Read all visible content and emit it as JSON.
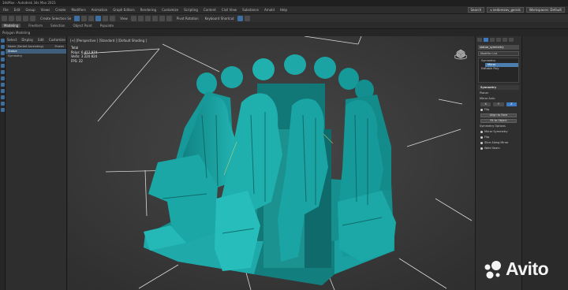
{
  "titlebar": {
    "text": "3dsMax - Autodesk 3ds Max 2023"
  },
  "menubar": {
    "items": [
      "File",
      "Edit",
      "Group",
      "Views",
      "Create",
      "Modifiers",
      "Animation",
      "Graph Editors",
      "Rendering",
      "Customize",
      "Scripting",
      "Content",
      "Civil View",
      "Substance",
      "Arnold",
      "Help"
    ],
    "user": "v.nedorezov_gerals",
    "workspace": "Workspaces: Default",
    "search_placeholder": "Search"
  },
  "toolbar": {
    "field": "Create Selection Se",
    "view": "View",
    "dropdown_a": "Pivot Rotation",
    "dropdown_b": "Keyboard Shortcut"
  },
  "ribbon": {
    "tabs": [
      "Modeling",
      "Freeform",
      "Selection",
      "Object Paint",
      "Populate"
    ],
    "active": "Modeling",
    "sub": "Polygon Modeling"
  },
  "scene": {
    "tabs": [
      "Select",
      "Display",
      "Edit",
      "Customize"
    ],
    "header": "Name (Sorted Ascending)",
    "header_right": "Frozen",
    "rows": [
      {
        "label": "Statue",
        "selected": true
      },
      {
        "label": "Symmetry",
        "selected": false
      }
    ]
  },
  "viewport": {
    "label": "[+] [Perspective ] [Standard ] [Default Shading ]",
    "stats": {
      "title": "Total",
      "polys_label": "Polys:",
      "polys": "6 412 974",
      "verts_label": "Verts:",
      "verts": "3 220 824",
      "fps_label": "FPS:",
      "fps": "22"
    },
    "statue_color": "#1a9c9c"
  },
  "cmdpanel": {
    "object_name": "statue_symmetry",
    "modifier_list": "Modifier List",
    "stack": [
      {
        "label": "Symmetry",
        "selected": false
      },
      {
        "label": "Mirror",
        "selected": true
      },
      {
        "label": "Editable Poly",
        "selected": false
      }
    ],
    "rollout": "Symmetry",
    "planar_label": "Planar",
    "mirror_axis_label": "Mirror Axis:",
    "axes": [
      "X",
      "Y",
      "Z"
    ],
    "active_axis": "Z",
    "flip_label": "Flip",
    "align_btn": "Align to Face",
    "fit_btn": "Fit to Object",
    "options_label": "Symmetry Options",
    "checks": [
      "Mirror Symmetry",
      "Flip",
      "Slice Along Mirror",
      "Weld Seam"
    ]
  },
  "watermark": {
    "text": "Avito"
  }
}
